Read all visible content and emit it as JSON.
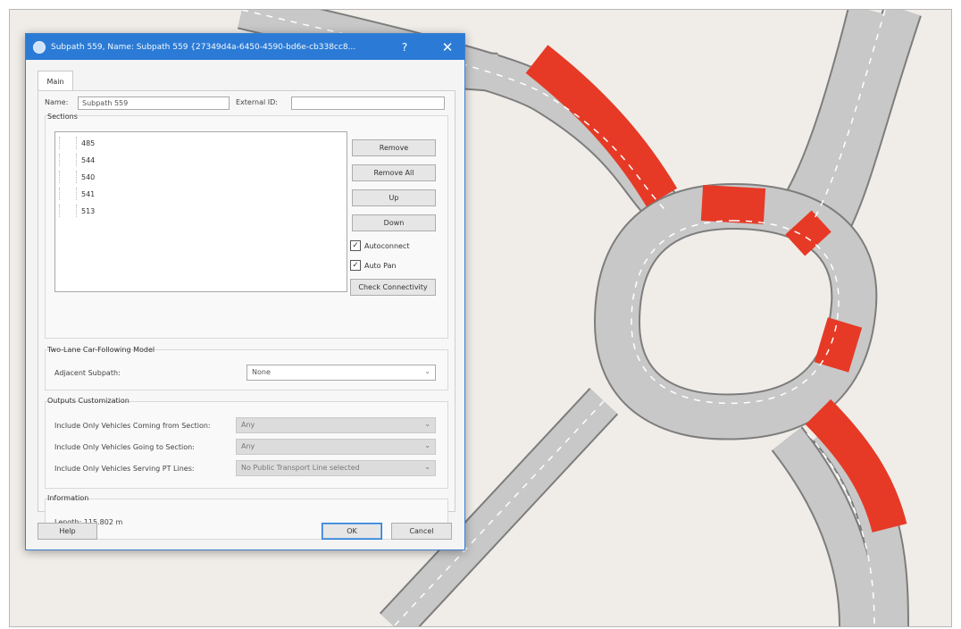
{
  "dialog": {
    "title": "Subpath 559, Name: Subpath 559 {27349d4a-6450-4590-bd6e-cb338cc8...",
    "help_glyph": "?",
    "close_glyph": "✕",
    "tab": "Main",
    "name_label": "Name:",
    "name_value": "Subpath 559",
    "external_id_label": "External ID:",
    "external_id_value": "",
    "sections": {
      "title": "Sections",
      "items": [
        "485",
        "544",
        "540",
        "541",
        "513"
      ],
      "buttons": {
        "remove": "Remove",
        "remove_all": "Remove All",
        "up": "Up",
        "down": "Down",
        "check_connectivity": "Check Connectivity"
      },
      "autoconnect_label": "Autoconnect",
      "autoconnect_checked": true,
      "autopan_label": "Auto Pan",
      "autopan_checked": true
    },
    "two_lane": {
      "title": "Two-Lane Car-Following Model",
      "adjacent_label": "Adjacent Subpath:",
      "adjacent_value": "None"
    },
    "outputs": {
      "title": "Outputs Customization",
      "coming_label": "Include Only Vehicles Coming from Section:",
      "coming_value": "Any",
      "going_label": "Include Only Vehicles Going to Section:",
      "going_value": "Any",
      "pt_label": "Include Only Vehicles Serving PT Lines:",
      "pt_value": "No Public Transport Line selected"
    },
    "information": {
      "title": "Information",
      "length": "Length: 115.802 m"
    },
    "footer": {
      "help": "Help",
      "ok": "OK",
      "cancel": "Cancel"
    }
  },
  "colors": {
    "titlebar": "#2b7bd6",
    "road": "#c8c8c8",
    "highlight": "#e63a26",
    "background": "#f0ede8"
  }
}
